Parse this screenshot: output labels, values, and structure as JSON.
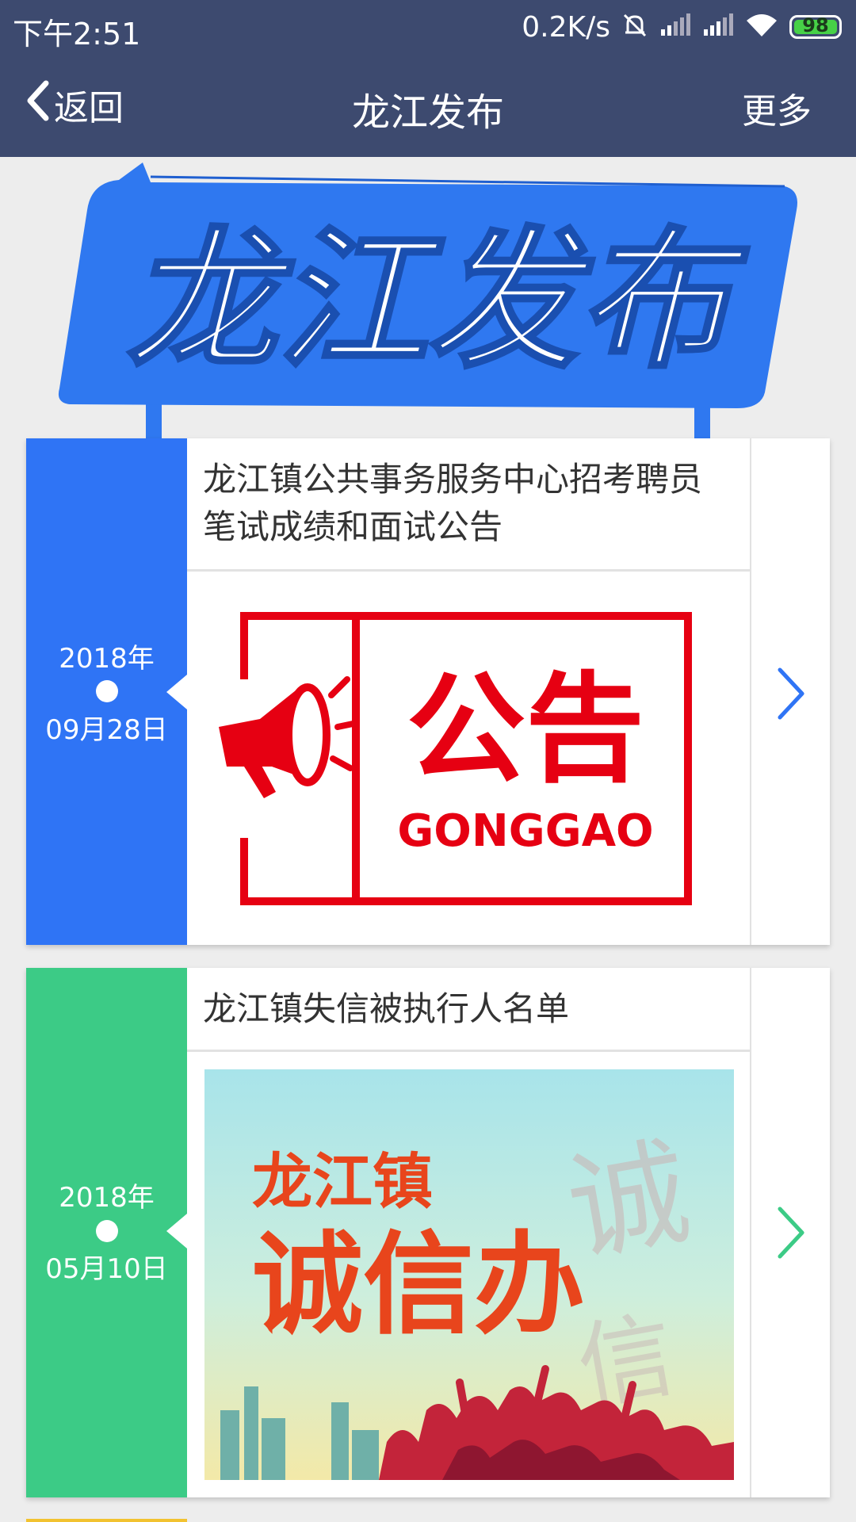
{
  "status_bar": {
    "time": "下午2:51",
    "network_speed": "0.2K/s",
    "battery": "98",
    "icons": [
      "mute-bell-icon",
      "signal-icon",
      "signal-icon",
      "wifi-icon",
      "battery-icon"
    ]
  },
  "nav": {
    "back_label": "返回",
    "title": "龙江发布",
    "more_label": "更多"
  },
  "banner": {
    "title": "龙江发布",
    "color": "#2f78f0"
  },
  "articles": [
    {
      "year": "2018年",
      "date": "09月28日",
      "title_line1": "龙江镇公共事务服务中心招考聘员",
      "title_line2": "笔试成绩和面试公告",
      "image_title": "公告",
      "image_subtitle": "GONGGAO",
      "accent": "#2f74f5"
    },
    {
      "year": "2018年",
      "date": "05月10日",
      "title_line1": "龙江镇失信被执行人名单",
      "image_title": "龙江镇",
      "image_subtitle": "诚信办",
      "accent": "#3ccb86"
    }
  ]
}
